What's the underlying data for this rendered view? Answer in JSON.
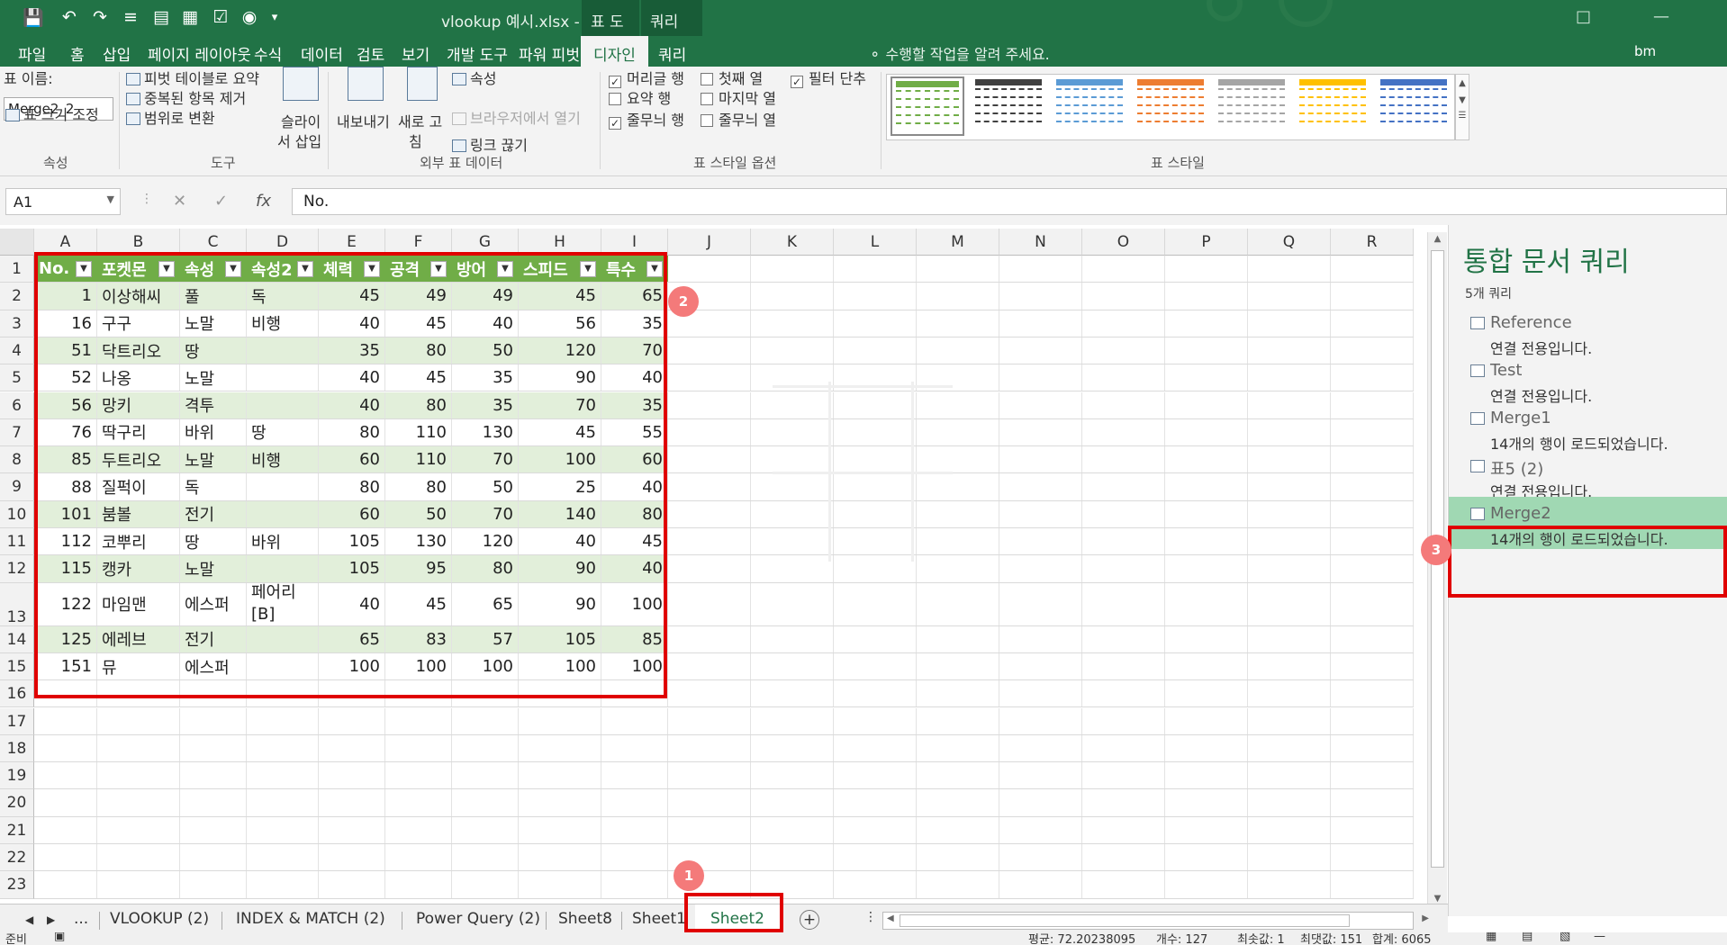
{
  "window": {
    "title": "vlookup 예시.xlsx - Excel",
    "context_tabs": [
      "표 도구",
      "쿼리 도구"
    ],
    "user": "bm"
  },
  "ribbon_tabs": [
    "파일",
    "홈",
    "삽입",
    "페이지 레이아웃",
    "수식",
    "데이터",
    "검토",
    "보기",
    "개발 도구",
    "파워 피벗",
    "디자인",
    "쿼리"
  ],
  "tell_me": "수행할 작업을 알려 주세요.",
  "ribbon": {
    "properties": {
      "label": "표 이름:",
      "table_name": "Merge2_2",
      "resize": "표 크기 조정",
      "group": "속성"
    },
    "tools": {
      "pivot": "피벗 테이블로 요약",
      "dedupe": "중복된 항목 제거",
      "convert": "범위로 변환",
      "slicer_1": "슬라이",
      "slicer_2": "서 삽입",
      "group": "도구"
    },
    "external": {
      "export_1": "내보내기",
      "refresh_1": "새로 고",
      "refresh_2": "침",
      "properties": "속성",
      "browser": "브라우저에서 열기",
      "unlink": "링크 끊기",
      "group": "외부 표 데이터"
    },
    "style_options": {
      "header_row": "머리글 행",
      "total_row": "요약 행",
      "banded_rows": "줄무늬 행",
      "first_col": "첫째 열",
      "last_col": "마지막 열",
      "banded_cols": "줄무늬 열",
      "filter_button": "필터 단추",
      "group": "표 스타일 옵션"
    },
    "table_styles": {
      "group": "표 스타일",
      "colors": [
        "#70ad47",
        "#404040",
        "#5b9bd5",
        "#ed7d31",
        "#a5a5a5",
        "#ffc000",
        "#4472c4"
      ]
    }
  },
  "formula_bar": {
    "cell_ref": "A1",
    "value": "No."
  },
  "columns": [
    "A",
    "B",
    "C",
    "D",
    "E",
    "F",
    "G",
    "H",
    "I",
    "J",
    "K",
    "L",
    "M",
    "N",
    "O",
    "P",
    "Q",
    "R"
  ],
  "rows": [
    "1",
    "2",
    "3",
    "4",
    "5",
    "6",
    "7",
    "8",
    "9",
    "10",
    "11",
    "12",
    "13",
    "14",
    "15",
    "16",
    "17",
    "18",
    "19",
    "20",
    "21",
    "22",
    "23"
  ],
  "table": {
    "headers": [
      "No.",
      "포켓몬",
      "속성",
      "속성2",
      "체력",
      "공격",
      "방어",
      "스피드",
      "특수"
    ],
    "data": [
      [
        "1",
        "이상해씨",
        "풀",
        "독",
        "45",
        "49",
        "49",
        "45",
        "65"
      ],
      [
        "16",
        "구구",
        "노말",
        "비행",
        "40",
        "45",
        "40",
        "56",
        "35"
      ],
      [
        "51",
        "닥트리오",
        "땅",
        "",
        "35",
        "80",
        "50",
        "120",
        "70"
      ],
      [
        "52",
        "나옹",
        "노말",
        "",
        "40",
        "45",
        "35",
        "90",
        "40"
      ],
      [
        "56",
        "망키",
        "격투",
        "",
        "40",
        "80",
        "35",
        "70",
        "35"
      ],
      [
        "76",
        "딱구리",
        "바위",
        "땅",
        "80",
        "110",
        "130",
        "45",
        "55"
      ],
      [
        "85",
        "두트리오",
        "노말",
        "비행",
        "60",
        "110",
        "70",
        "100",
        "60"
      ],
      [
        "88",
        "질퍽이",
        "독",
        "",
        "80",
        "80",
        "50",
        "25",
        "40"
      ],
      [
        "101",
        "붐볼",
        "전기",
        "",
        "60",
        "50",
        "70",
        "140",
        "80"
      ],
      [
        "112",
        "코뿌리",
        "땅",
        "바위",
        "105",
        "130",
        "120",
        "40",
        "45"
      ],
      [
        "115",
        "캥카",
        "노말",
        "",
        "105",
        "95",
        "80",
        "90",
        "40"
      ],
      [
        "122",
        "마임맨",
        "에스퍼",
        "페어리\n[B]",
        "40",
        "45",
        "65",
        "90",
        "100"
      ],
      [
        "125",
        "에레브",
        "전기",
        "",
        "65",
        "83",
        "57",
        "105",
        "85"
      ],
      [
        "151",
        "뮤",
        "에스퍼",
        "",
        "100",
        "100",
        "100",
        "100",
        "100"
      ]
    ]
  },
  "query_pane": {
    "title": "통합 문서 쿼리",
    "count": "5개 쿼리",
    "items": [
      {
        "name": "Reference",
        "status": "연결 전용입니다."
      },
      {
        "name": "Test",
        "status": "연결 전용입니다."
      },
      {
        "name": "Merge1",
        "status": "14개의 행이 로드되었습니다."
      },
      {
        "name": "표5 (2)",
        "status": "연결 전용입니다."
      },
      {
        "name": "Merge2",
        "status": "14개의 행이 로드되었습니다."
      }
    ]
  },
  "sheet_tabs": [
    "...",
    "VLOOKUP (2)",
    "INDEX & MATCH (2)",
    "Power Query (2)",
    "Sheet8",
    "Sheet1",
    "Sheet2"
  ],
  "badges": [
    "1",
    "2",
    "3"
  ],
  "status_bar": {
    "ready": "준비",
    "average": "평균: 72.20238095",
    "count": "개수: 127",
    "min": "최솟값: 1",
    "max": "최댓값: 151",
    "sum": "합계: 6065"
  }
}
